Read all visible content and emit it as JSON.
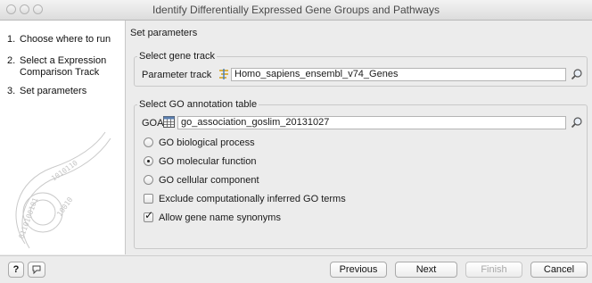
{
  "window": {
    "title": "Identify Differentially Expressed Gene Groups and Pathways"
  },
  "steps": [
    {
      "num": "1.",
      "label": "Choose where to run"
    },
    {
      "num": "2.",
      "label": "Select a Expression",
      "label_cont": "Comparison Track"
    },
    {
      "num": "3.",
      "label": "Set parameters"
    }
  ],
  "main": {
    "heading": "Set parameters",
    "gene_track": {
      "legend": "Select gene track",
      "label": "Parameter track",
      "value": "Homo_sapiens_ensembl_v74_Genes"
    },
    "go_table": {
      "legend": "Select GO annotation table",
      "label": "GOA",
      "value": "go_association_goslim_20131027",
      "options": [
        {
          "label": "GO biological process",
          "selected": false
        },
        {
          "label": "GO molecular function",
          "selected": true
        },
        {
          "label": "GO cellular component",
          "selected": false
        }
      ],
      "checkboxes": [
        {
          "label": "Exclude computationally inferred GO terms",
          "checked": false
        },
        {
          "label": "Allow gene name synonyms",
          "checked": true
        }
      ]
    }
  },
  "footer": {
    "help_label": "?",
    "previous": "Previous",
    "next": "Next",
    "finish": "Finish",
    "cancel": "Cancel"
  },
  "icons": {
    "track": "gene-track-icon",
    "table": "table-icon",
    "browse": "browse-icon",
    "chat": "chat-icon"
  }
}
